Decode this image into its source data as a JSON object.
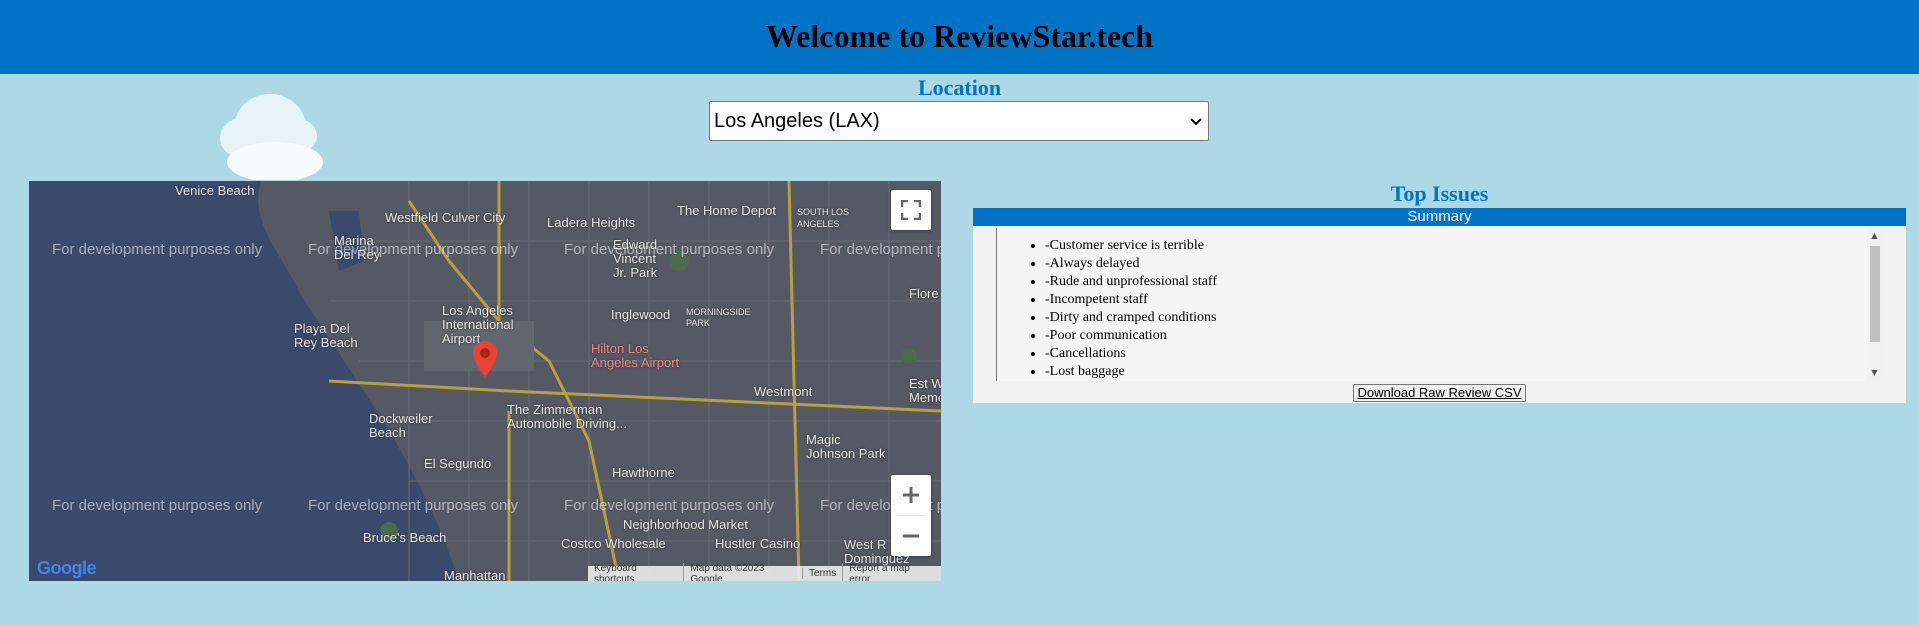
{
  "header": {
    "title": "Welcome to ReviewStar.tech"
  },
  "location": {
    "label": "Location",
    "selected": "Los Angeles (LAX)"
  },
  "map": {
    "dev_watermark": "For development purposes only",
    "place_labels": {
      "venice_beach": "Venice Beach",
      "marina_del_rey": "Marina\nDel Rey",
      "westfield": "Westfield Culver City",
      "ladera_heights": "Ladera Heights",
      "home_depot": "The Home Depot",
      "south_los_angeles": "SOUTH LOS\nANGELES",
      "edward_vincent": "Edward\nVincent\nJr. Park",
      "florence": "Flore",
      "lax": "Los Angeles\nInternational\nAirport",
      "playa_del_rey": "Playa Del\nRey Beach",
      "inglewood": "Inglewood",
      "morningside_park": "MORNINGSIDE\nPARK",
      "hilton": "Hilton Los\nAngeles Airport",
      "zimmerman": "The Zimmerman\nAutomobile Driving...",
      "westmont": "Westmont",
      "west_memorial": "Est W\nMemor",
      "dockweiler": "Dockweiler\nBeach",
      "el_segundo": "El Segundo",
      "hawthorne": "Hawthorne",
      "magic_johnson": "Magic\nJohnson Park",
      "neighborhood_market": "Neighborhood Market",
      "bruces_beach": "Bruce's Beach",
      "costco": "Costco Wholesale",
      "hustler_casino": "Hustler Casino",
      "west_rancho": "West R\nDominguez",
      "manhattan": "Manhattan"
    },
    "attribution": {
      "shortcuts": "Keyboard shortcuts",
      "map_data": "Map data ©2023 Google",
      "terms": "Terms",
      "report": "Report a map error"
    },
    "logo": "Google"
  },
  "issues": {
    "title": "Top Issues",
    "summary_label": "Summary",
    "items": [
      "-Customer service is terrible",
      "-Always delayed",
      "-Rude and unprofessional staff",
      "-Incompetent staff",
      "-Dirty and cramped conditions",
      "-Poor communication",
      "-Cancellations",
      "-Lost baggage"
    ],
    "download_label": "Download Raw Review CSV"
  },
  "colors": {
    "header_bg": "#0073c6",
    "page_bg": "#add8e6",
    "accent_text": "#0073c6",
    "pin": "#ea4335"
  }
}
